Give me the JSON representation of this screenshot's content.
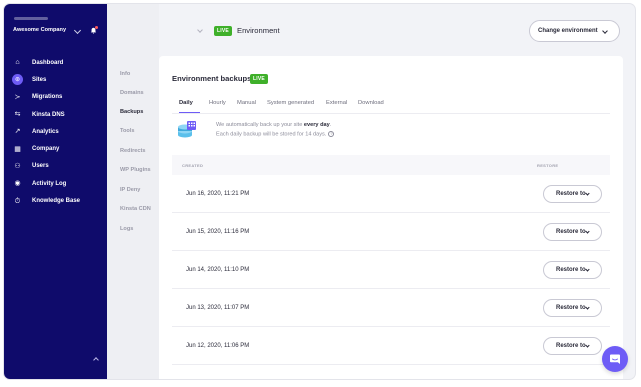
{
  "sidebar": {
    "company": "Awesome Company",
    "items": [
      {
        "label": "Dashboard",
        "icon": "⌂"
      },
      {
        "label": "Sites",
        "icon": "⊛"
      },
      {
        "label": "Migrations",
        "icon": "≻"
      },
      {
        "label": "Kinsta DNS",
        "icon": "⇆"
      },
      {
        "label": "Analytics",
        "icon": "↗"
      },
      {
        "label": "Company",
        "icon": "▦"
      },
      {
        "label": "Users",
        "icon": "⚇"
      },
      {
        "label": "Activity Log",
        "icon": "◉"
      },
      {
        "label": "Knowledge Base",
        "icon": "⏱"
      }
    ]
  },
  "subnav": {
    "items": [
      "Info",
      "Domains",
      "Backups",
      "Tools",
      "Redirects",
      "WP Plugins",
      "IP Deny",
      "Kinsta CDN",
      "Logs"
    ]
  },
  "topbar": {
    "live_badge": "LIVE",
    "environment_label": "Environment",
    "change_env_label": "Change environment"
  },
  "backups": {
    "title": "Environment backups",
    "live_badge": "LIVE",
    "tabs": [
      "Daily",
      "Hourly",
      "Manual",
      "System generated",
      "External",
      "Download"
    ],
    "info_prefix": "We automatically back up your site ",
    "info_bold": "every day",
    "info_suffix": ".",
    "info_line2": "Each daily backup will be stored for 14 days.",
    "col_created": "CREATED",
    "col_restore": "RESTORE",
    "restore_label": "Restore to",
    "rows": [
      "Jun 16, 2020, 11:21 PM",
      "Jun 15, 2020, 11:16 PM",
      "Jun 14, 2020, 11:10 PM",
      "Jun 13, 2020, 11:07 PM",
      "Jun 12, 2020, 11:06 PM"
    ]
  },
  "colors": {
    "sidebar_bg": "#0f0b6b",
    "accent": "#6e5cf6",
    "live_green": "#3fb02a"
  }
}
